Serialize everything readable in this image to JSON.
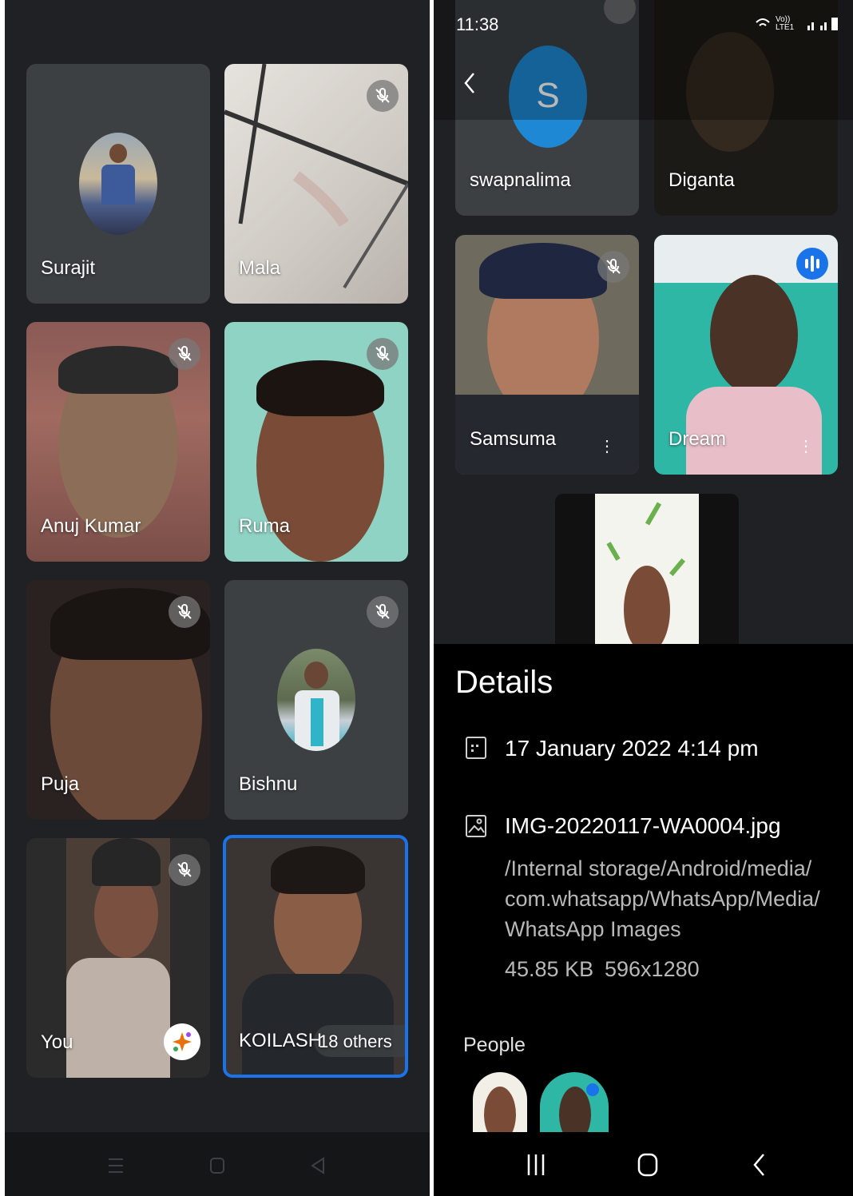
{
  "left_call": {
    "tiles": [
      {
        "name": "Surajit"
      },
      {
        "name": "Mala"
      },
      {
        "name": "Anuj Kumar"
      },
      {
        "name": "Ruma"
      },
      {
        "name": "Puja"
      },
      {
        "name": "Bishnu"
      },
      {
        "name": "You"
      },
      {
        "name": "KOILASH",
        "others": "18 others"
      }
    ]
  },
  "right_call": {
    "status_bar": {
      "time": "11:38",
      "network": "Vo)) LTE1"
    },
    "tiles": [
      {
        "name": "swapnalima",
        "initial": "S"
      },
      {
        "name": "Diganta"
      },
      {
        "name": "Samsuma"
      },
      {
        "name": "Dream"
      }
    ]
  },
  "details": {
    "title": "Details",
    "date": "17 January 2022 4:14 pm",
    "filename": "IMG-20220117-WA0004.jpg",
    "path": "/Internal storage/Android/media/ com.whatsapp/WhatsApp/Media/ WhatsApp Images",
    "size": "45.85 KB",
    "resolution": "596x1280",
    "people_label": "People"
  },
  "colors": {
    "accent_blue": "#1a73e8",
    "initial_blue": "#1e88d4",
    "meet_bg": "#202124"
  },
  "icons": [
    "mic-off-icon",
    "back-arrow-icon",
    "calendar-icon",
    "image-icon",
    "speaking-icon",
    "sparkle-icon",
    "more-vert-icon",
    "menu-icon",
    "home-icon",
    "back-icon",
    "recents-icon"
  ]
}
